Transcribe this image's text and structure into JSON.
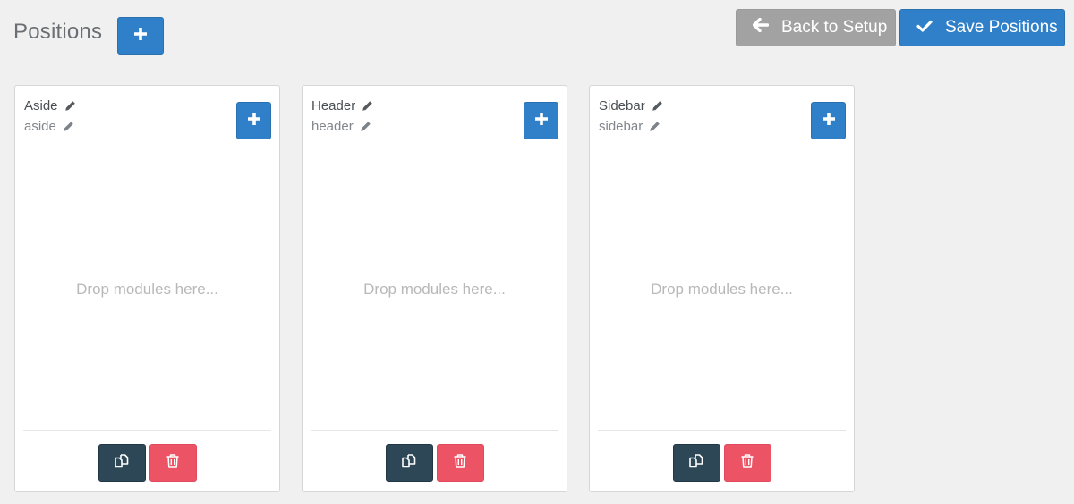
{
  "header": {
    "title": "Positions",
    "add_icon": "plus-icon",
    "back_label": "Back to Setup",
    "back_icon": "arrow-left-icon",
    "save_label": "Save Positions",
    "save_icon": "check-icon"
  },
  "positions": [
    {
      "name": "Aside",
      "slug": "aside",
      "placeholder": "Drop modules here..."
    },
    {
      "name": "Header",
      "slug": "header",
      "placeholder": "Drop modules here..."
    },
    {
      "name": "Sidebar",
      "slug": "sidebar",
      "placeholder": "Drop modules here..."
    }
  ],
  "colors": {
    "primary": "#2f80c9",
    "secondary": "#a2a2a2",
    "dark": "#2e4756",
    "danger": "#ec5466",
    "background": "#f0f0f0"
  }
}
